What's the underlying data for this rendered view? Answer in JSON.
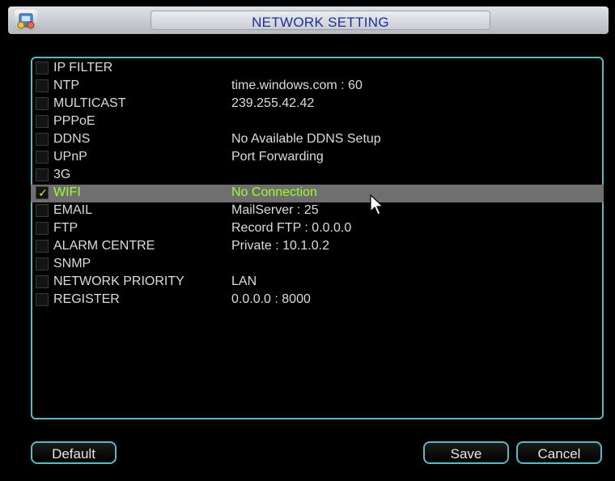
{
  "window": {
    "title": "NETWORK SETTING",
    "icon": "network-settings-icon"
  },
  "settings": [
    {
      "name": "IP FILTER",
      "value": "",
      "checked": false,
      "selected": false
    },
    {
      "name": "NTP",
      "value": "time.windows.com : 60",
      "checked": false,
      "selected": false
    },
    {
      "name": "MULTICAST",
      "value": "239.255.42.42",
      "checked": false,
      "selected": false
    },
    {
      "name": "PPPoE",
      "value": "",
      "checked": false,
      "selected": false
    },
    {
      "name": "DDNS",
      "value": "No Available DDNS Setup",
      "checked": false,
      "selected": false
    },
    {
      "name": "UPnP",
      "value": "Port Forwarding",
      "checked": false,
      "selected": false
    },
    {
      "name": "3G",
      "value": "",
      "checked": false,
      "selected": false
    },
    {
      "name": "WIFI",
      "value": "No Connection",
      "checked": true,
      "selected": true
    },
    {
      "name": "EMAIL",
      "value": "MailServer : 25",
      "checked": false,
      "selected": false
    },
    {
      "name": "FTP",
      "value": "Record FTP : 0.0.0.0",
      "checked": false,
      "selected": false
    },
    {
      "name": "ALARM CENTRE",
      "value": "Private : 10.1.0.2",
      "checked": false,
      "selected": false
    },
    {
      "name": "SNMP",
      "value": "",
      "checked": false,
      "selected": false
    },
    {
      "name": "NETWORK PRIORITY",
      "value": "LAN",
      "checked": false,
      "selected": false
    },
    {
      "name": "REGISTER",
      "value": "0.0.0.0 : 8000",
      "checked": false,
      "selected": false
    }
  ],
  "buttons": {
    "default_label": "Default",
    "save_label": "Save",
    "cancel_label": "Cancel"
  },
  "colors": {
    "accent_border": "#5fb7c4",
    "selected_text": "#9cff2b",
    "title_text": "#1e2f9b"
  }
}
